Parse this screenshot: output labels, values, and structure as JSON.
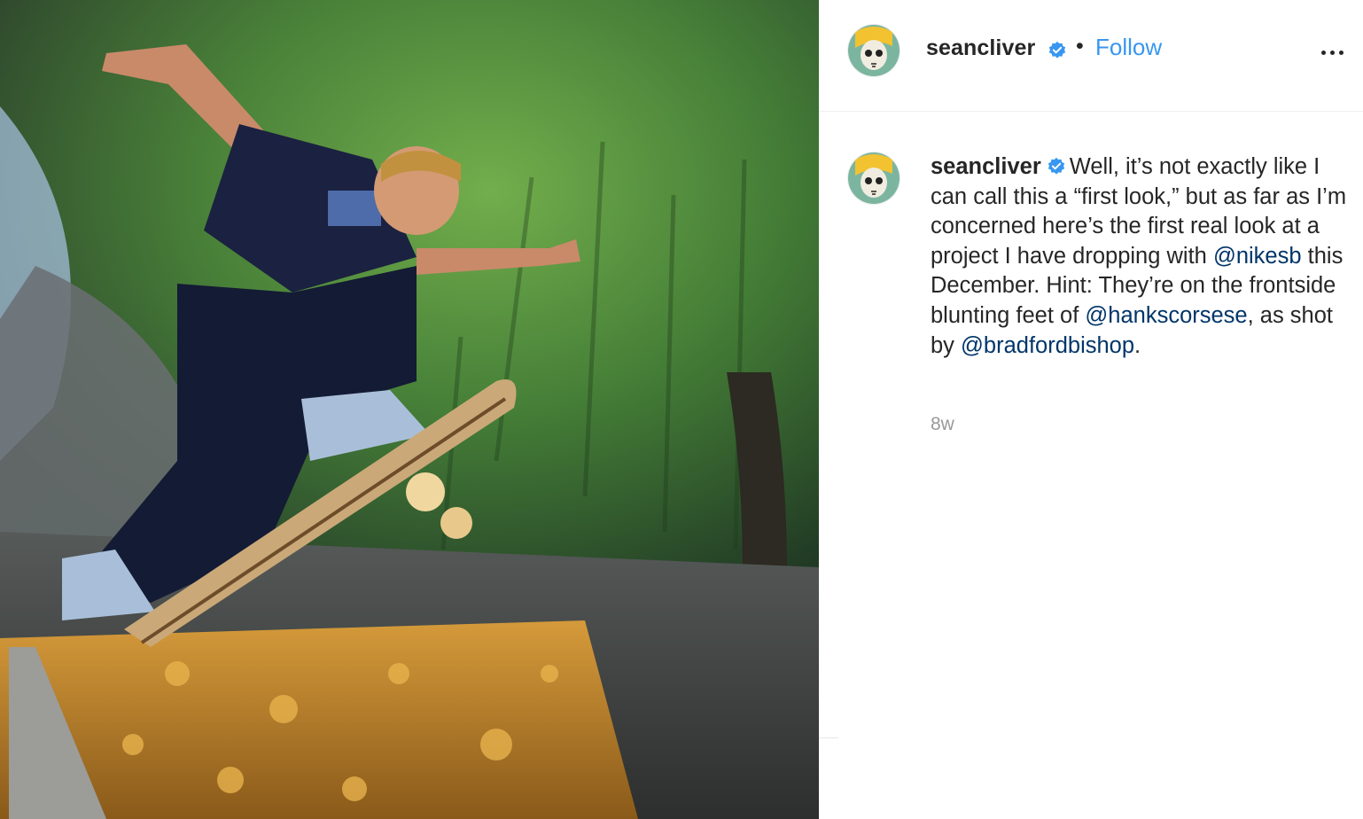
{
  "post": {
    "username": "seancliver",
    "verified": true,
    "separator": "•",
    "follow_label": "Follow",
    "more_icon": "more-horizontal-icon",
    "caption": {
      "part1": "Well, it’s not exactly like I can call this a “first look,” but as far as I’m concerned here’s the first real look at a project I have dropping with ",
      "mention1": "@nikesb",
      "part2": " this December. Hint: They’re on the frontside blunting feet of ",
      "mention2": "@hankscorsese",
      "part3": ", as shot by ",
      "mention3": "@bradfordbishop",
      "part4": "."
    },
    "timestamp": "8w"
  },
  "colors": {
    "follow_blue": "#3897f0",
    "mention_navy": "#003569",
    "verified_blue": "#3897f0",
    "timestamp_gray": "#999999"
  }
}
